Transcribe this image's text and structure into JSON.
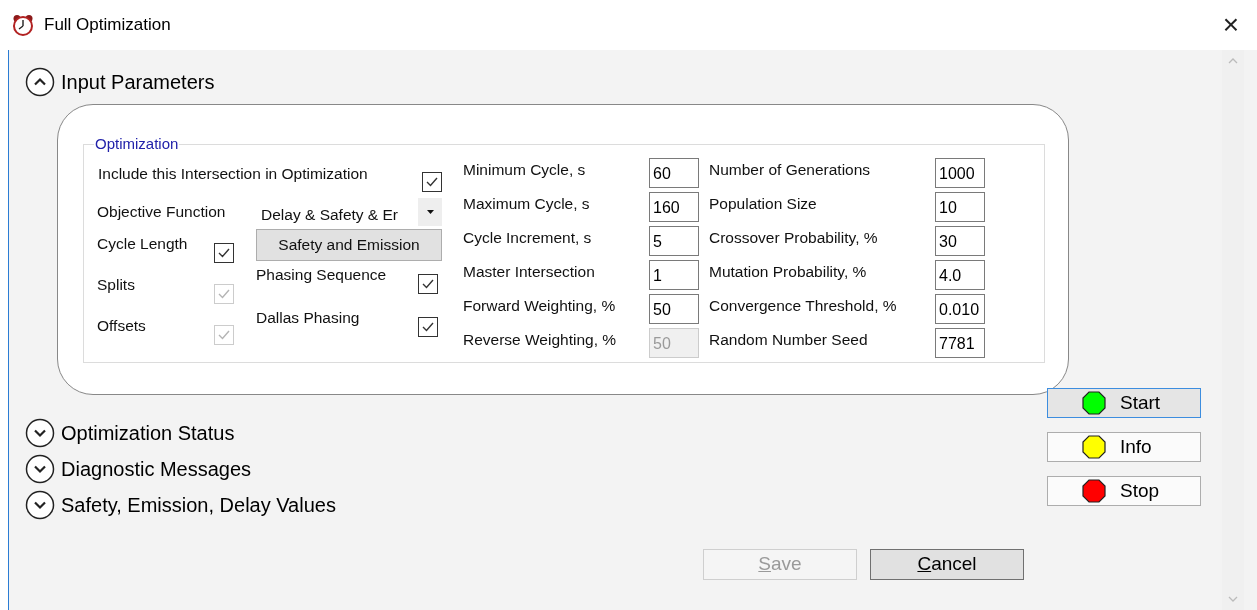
{
  "window": {
    "title": "Full Optimization",
    "close": "×"
  },
  "sections": [
    {
      "title": "Input Parameters",
      "expanded": true
    },
    {
      "title": "Optimization Status",
      "expanded": false
    },
    {
      "title": "Diagnostic Messages",
      "expanded": false
    },
    {
      "title": "Safety, Emission, Delay Values",
      "expanded": false
    }
  ],
  "optimization": {
    "title": "Optimization",
    "include": {
      "label": "Include this Intersection in Optimization",
      "checked": true,
      "disabled": false
    },
    "objective": {
      "label": "Objective Function",
      "value": "Delay & Safety & Er"
    },
    "checks": [
      {
        "label": "Cycle Length",
        "checked": true,
        "disabled": false
      },
      {
        "label": "Splits",
        "checked": true,
        "disabled": true
      },
      {
        "label": "Offsets",
        "checked": true,
        "disabled": true
      }
    ],
    "safety_button": "Safety and Emission",
    "options": [
      {
        "label": "Phasing Sequence",
        "checked": true,
        "disabled": false
      },
      {
        "label": "Dallas Phasing",
        "checked": true,
        "disabled": false
      }
    ],
    "cycle_fields": [
      {
        "label": "Minimum Cycle, s",
        "value": "60",
        "disabled": false
      },
      {
        "label": "Maximum Cycle, s",
        "value": "160",
        "disabled": false
      },
      {
        "label": "Cycle Increment, s",
        "value": "5",
        "disabled": false
      },
      {
        "label": "Master Intersection",
        "value": "1",
        "disabled": false
      },
      {
        "label": "Forward Weighting, %",
        "value": "50",
        "disabled": false
      },
      {
        "label": "Reverse Weighting, %",
        "value": "50",
        "disabled": true
      }
    ],
    "ga_fields": [
      {
        "label": "Number of Generations",
        "value": "1000",
        "disabled": false
      },
      {
        "label": "Population Size",
        "value": "10",
        "disabled": false
      },
      {
        "label": "Crossover Probability, %",
        "value": "30",
        "disabled": false
      },
      {
        "label": "Mutation Probability, %",
        "value": "4.0",
        "disabled": false
      },
      {
        "label": "Convergence Threshold, %",
        "value": "0.010",
        "disabled": false
      },
      {
        "label": "Random Number Seed",
        "value": "7781",
        "disabled": false
      }
    ]
  },
  "actions": [
    {
      "label": "Start",
      "color": "#00ff00",
      "selected": true
    },
    {
      "label": "Info",
      "color": "#ffff00",
      "selected": false
    },
    {
      "label": "Stop",
      "color": "#ff0000",
      "selected": false
    }
  ],
  "footer": [
    {
      "label": "Save",
      "disabled": true
    },
    {
      "label": "Cancel",
      "disabled": false
    }
  ]
}
